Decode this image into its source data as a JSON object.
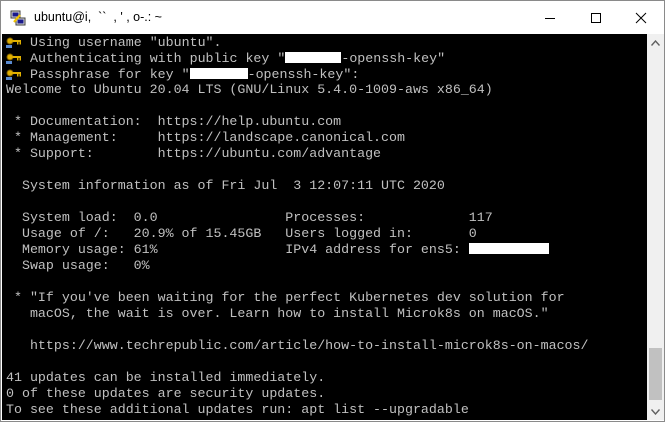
{
  "window": {
    "title": "ubuntu@i,  ``  , ' , o-.: ~"
  },
  "colors": {
    "terminal_bg": "#000000",
    "terminal_fg": "#c0c0c0",
    "redaction": "#ffffff"
  },
  "icons": {
    "app": "putty-icon",
    "key": "key-icon"
  },
  "terminal": {
    "lines": [
      {
        "text": "Using username \"ubuntu\"."
      },
      {
        "pre": "Authenticating with public key \"",
        "post": "-openssh-key\""
      },
      {
        "pre": "Passphrase for key \"",
        "post": "-openssh-key\":"
      },
      {
        "text": "Welcome to Ubuntu 20.04 LTS (GNU/Linux 5.4.0-1009-aws x86_64)"
      },
      {
        "text": " * Documentation:  https://help.ubuntu.com"
      },
      {
        "text": " * Management:     https://landscape.canonical.com"
      },
      {
        "text": " * Support:        https://ubuntu.com/advantage"
      },
      {
        "text": "  System information as of Fri Jul  3 12:07:11 UTC 2020"
      },
      {
        "text": "  System load:  0.0                Processes:             117"
      },
      {
        "text": "  Usage of /:   20.9% of 15.45GB   Users logged in:       0"
      },
      {
        "pre": "  Memory usage: 61%                IPv4 address for ens5: "
      },
      {
        "text": "  Swap usage:   0%"
      },
      {
        "text": " * \"If you've been waiting for the perfect Kubernetes dev solution for"
      },
      {
        "text": "   macOS, the wait is over. Learn how to install Microk8s on macOS.\""
      },
      {
        "text": "   https://www.techrepublic.com/article/how-to-install-microk8s-on-macos/"
      },
      {
        "text": "41 updates can be installed immediately."
      },
      {
        "text": "0 of these updates are security updates."
      },
      {
        "text": "To see these additional updates run: apt list --upgradable"
      }
    ]
  }
}
